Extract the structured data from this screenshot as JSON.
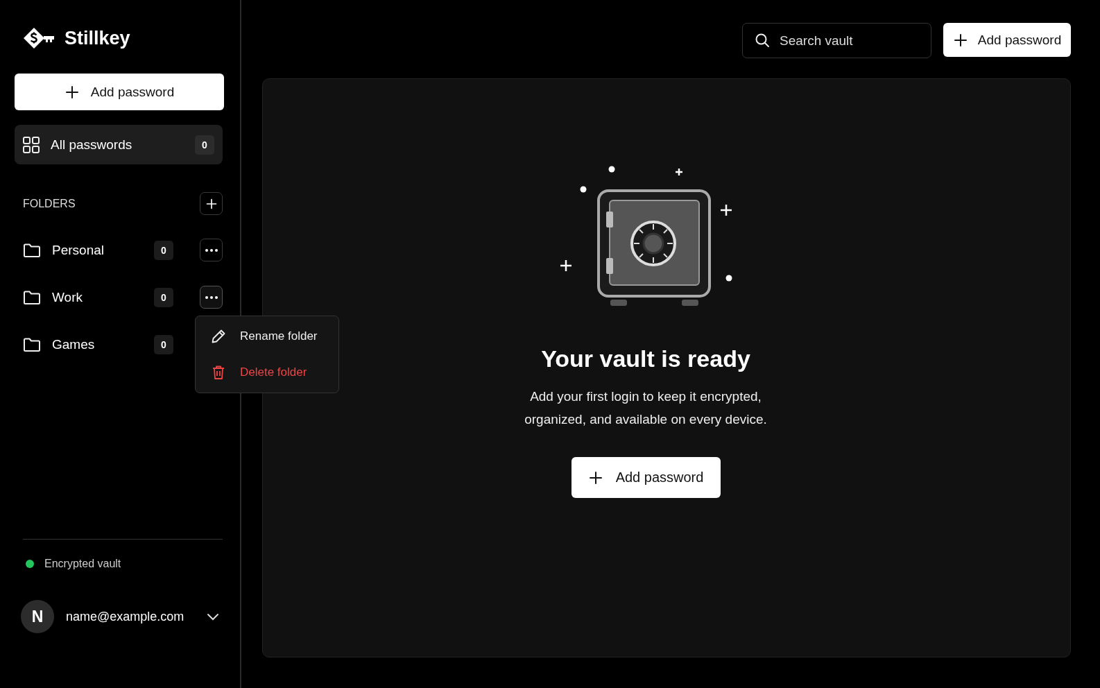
{
  "brand": {
    "name": "Stillkey"
  },
  "sidebar": {
    "add_button": "Add password",
    "nav": [
      {
        "label": "All passwords",
        "count": "0",
        "selected": true
      }
    ],
    "folders_heading": "FOLDERS",
    "folders": [
      {
        "label": "Personal",
        "count": "0",
        "selected": false,
        "menu_open": false,
        "show_more": true
      },
      {
        "label": "Work",
        "count": "0",
        "selected": false,
        "menu_open": true,
        "show_more": true
      },
      {
        "label": "Games",
        "count": "0",
        "selected": false,
        "menu_open": false,
        "show_more": false
      }
    ],
    "folder_menu": [
      {
        "label": "Rename folder",
        "kind": "rename"
      },
      {
        "label": "Delete folder",
        "kind": "delete"
      }
    ],
    "status": {
      "label": "Encrypted vault",
      "color": "#22c55e"
    },
    "user": {
      "initial": "N",
      "email": "name@example.com"
    }
  },
  "header": {
    "search": {
      "placeholder": "Search vault"
    },
    "add_button": "Add password"
  },
  "empty_state": {
    "title": "Your vault is ready",
    "text": "Add your first login to keep it encrypted, organized, and available on every device.",
    "button": "Add password"
  }
}
